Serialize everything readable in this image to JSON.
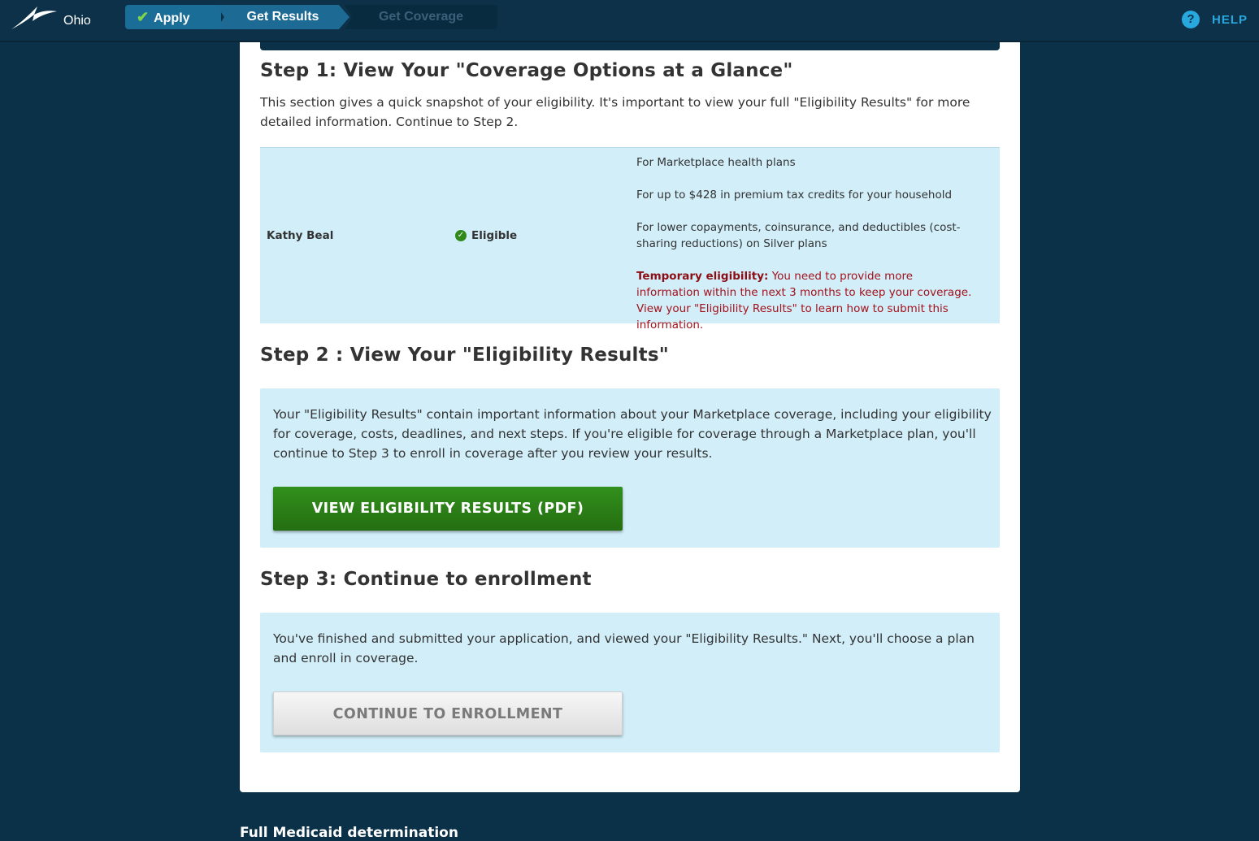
{
  "header": {
    "state": "Ohio",
    "steps": [
      {
        "label": "Apply",
        "status": "complete"
      },
      {
        "label": "Get Results",
        "status": "current"
      },
      {
        "label": "Get Coverage",
        "status": "upcoming"
      }
    ],
    "help_label": "HELP",
    "help_icon": "?"
  },
  "step1": {
    "heading": "Step 1: View Your \"Coverage Options at a Glance\"",
    "intro": "This section gives a quick snapshot of your eligibility. It's important to view your full \"Eligibility Results\" for more detailed information. Continue to Step 2.",
    "person": {
      "name": "Kathy Beal",
      "status": "Eligible",
      "details": [
        "For Marketplace health plans",
        "For up to $428 in premium tax credits for your household",
        "For lower copayments, coinsurance, and deductibles (cost-sharing reductions) on Silver plans"
      ],
      "warning_label": "Temporary eligibility:",
      "warning_text": " You need to provide more information within the next 3 months to keep your coverage. View your \"Eligibility Results\" to learn how to submit this information."
    }
  },
  "step2": {
    "heading": "Step 2 : View Your \"Eligibility Results\"",
    "body": "Your \"Eligibility Results\" contain important information about your Marketplace coverage, including your eligibility for coverage, costs, deadlines, and next steps. If you're eligible for coverage through a Marketplace plan, you'll continue to Step 3 to enroll in coverage after you review your results.",
    "button_label": "VIEW ELIGIBILITY RESULTS (PDF)"
  },
  "step3": {
    "heading": "Step 3: Continue to enrollment",
    "body": "You've finished and submitted your application, and viewed your \"Eligibility Results.\" Next, you'll choose a plan and enroll in coverage.",
    "button_label": "CONTINUE TO ENROLLMENT"
  },
  "footer": {
    "partial_text": "Full Medicaid determination"
  },
  "colors": {
    "page_bg": "#0a3147",
    "info_bg": "#d1eef9",
    "primary_button": "#2a7d16",
    "warning_text": "#a3121b",
    "help_accent": "#29a8e0"
  }
}
